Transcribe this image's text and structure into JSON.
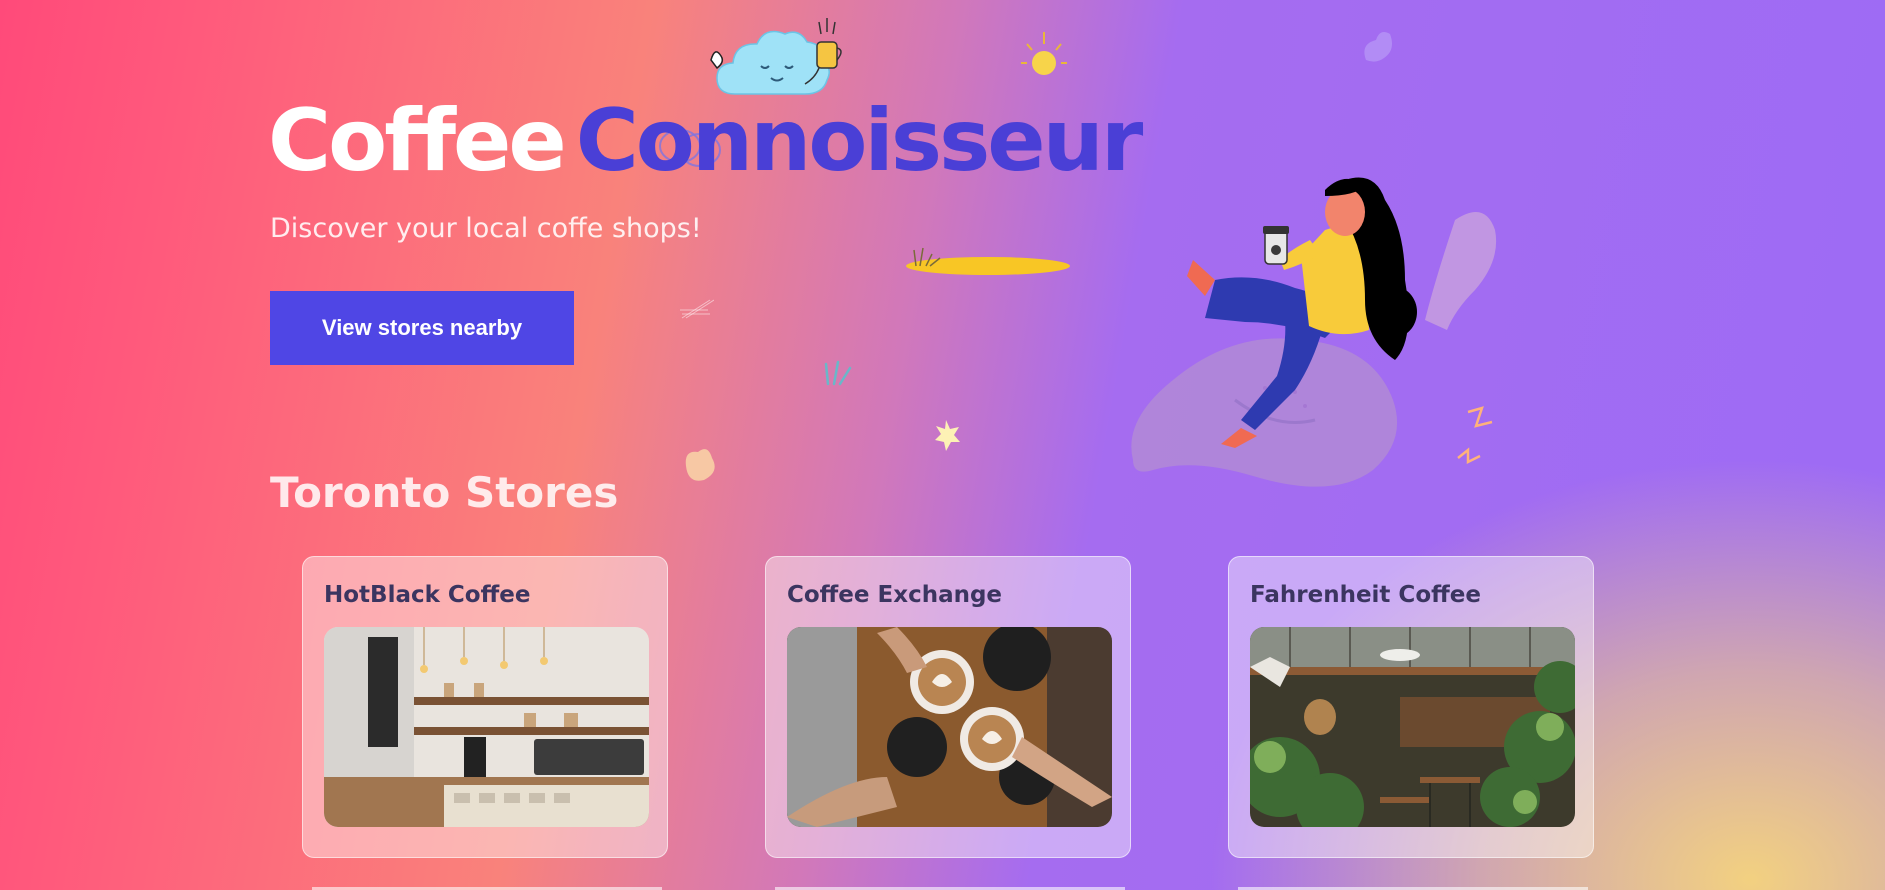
{
  "hero": {
    "title_word1": "Coffee",
    "title_word2": "Connoisseur",
    "subtitle": "Discover your local coffe shops!",
    "cta_label": "View stores nearby"
  },
  "section": {
    "title": "Toronto Stores"
  },
  "stores": [
    {
      "name": "HotBlack Coffee",
      "photo": "cafe-counter-photo"
    },
    {
      "name": "Coffee Exchange",
      "photo": "latte-cheers-photo"
    },
    {
      "name": "Fahrenheit Coffee",
      "photo": "plant-filled-cafe-photo"
    }
  ],
  "colors": {
    "accent": "#4f46e5",
    "title_accent": "#4a3fd6",
    "card_title": "#3b3560",
    "gradient_pink": "#ff4a7a",
    "gradient_purple": "#9d6bf5",
    "gradient_yellow": "#f7d67a"
  },
  "icons": [
    "cloud-mascot-icon",
    "sun-icon",
    "leaf-icon",
    "sparkle-icon",
    "zigzag-icon",
    "woman-with-coffee-illustration"
  ]
}
